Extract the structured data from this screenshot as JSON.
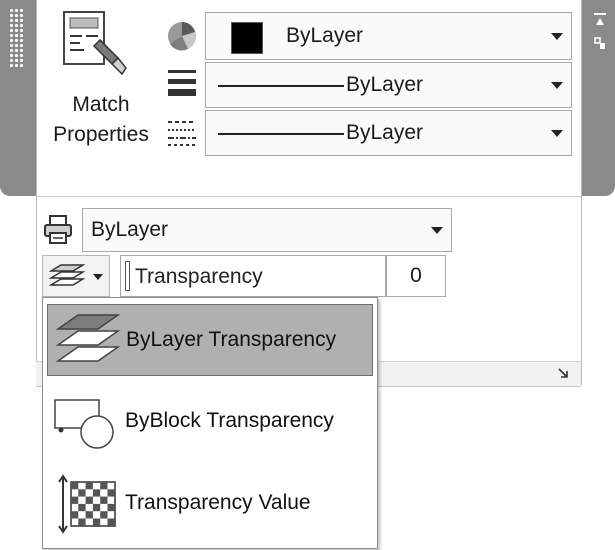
{
  "match_properties": {
    "label_line1": "Match",
    "label_line2": "Properties",
    "icon": "match-properties-icon"
  },
  "color_dropdown": {
    "value": "ByLayer",
    "icon": "color-wheel-icon",
    "swatch_color": "#000000"
  },
  "lineweight_dropdown": {
    "value": "ByLayer",
    "icon": "lineweight-icon"
  },
  "linetype_dropdown": {
    "value": "ByLayer",
    "icon": "linetype-icon"
  },
  "plotstyle_dropdown": {
    "value": "ByLayer",
    "icon": "plot-style-icon"
  },
  "transparency": {
    "field_label": "Transparency",
    "value": "0",
    "icon": "transparency-layers-icon"
  },
  "transparency_menu": {
    "items": [
      {
        "label": "ByLayer Transparency",
        "icon": "bylayer-transparency-icon",
        "selected": true
      },
      {
        "label": "ByBlock Transparency",
        "icon": "byblock-transparency-icon",
        "selected": false
      },
      {
        "label": "Transparency Value",
        "icon": "transparency-value-icon",
        "selected": false
      }
    ]
  },
  "colors": {
    "grip": "#8a8a8a",
    "selected_item": "#b0b0b0",
    "panel_bg": "#ffffff"
  }
}
